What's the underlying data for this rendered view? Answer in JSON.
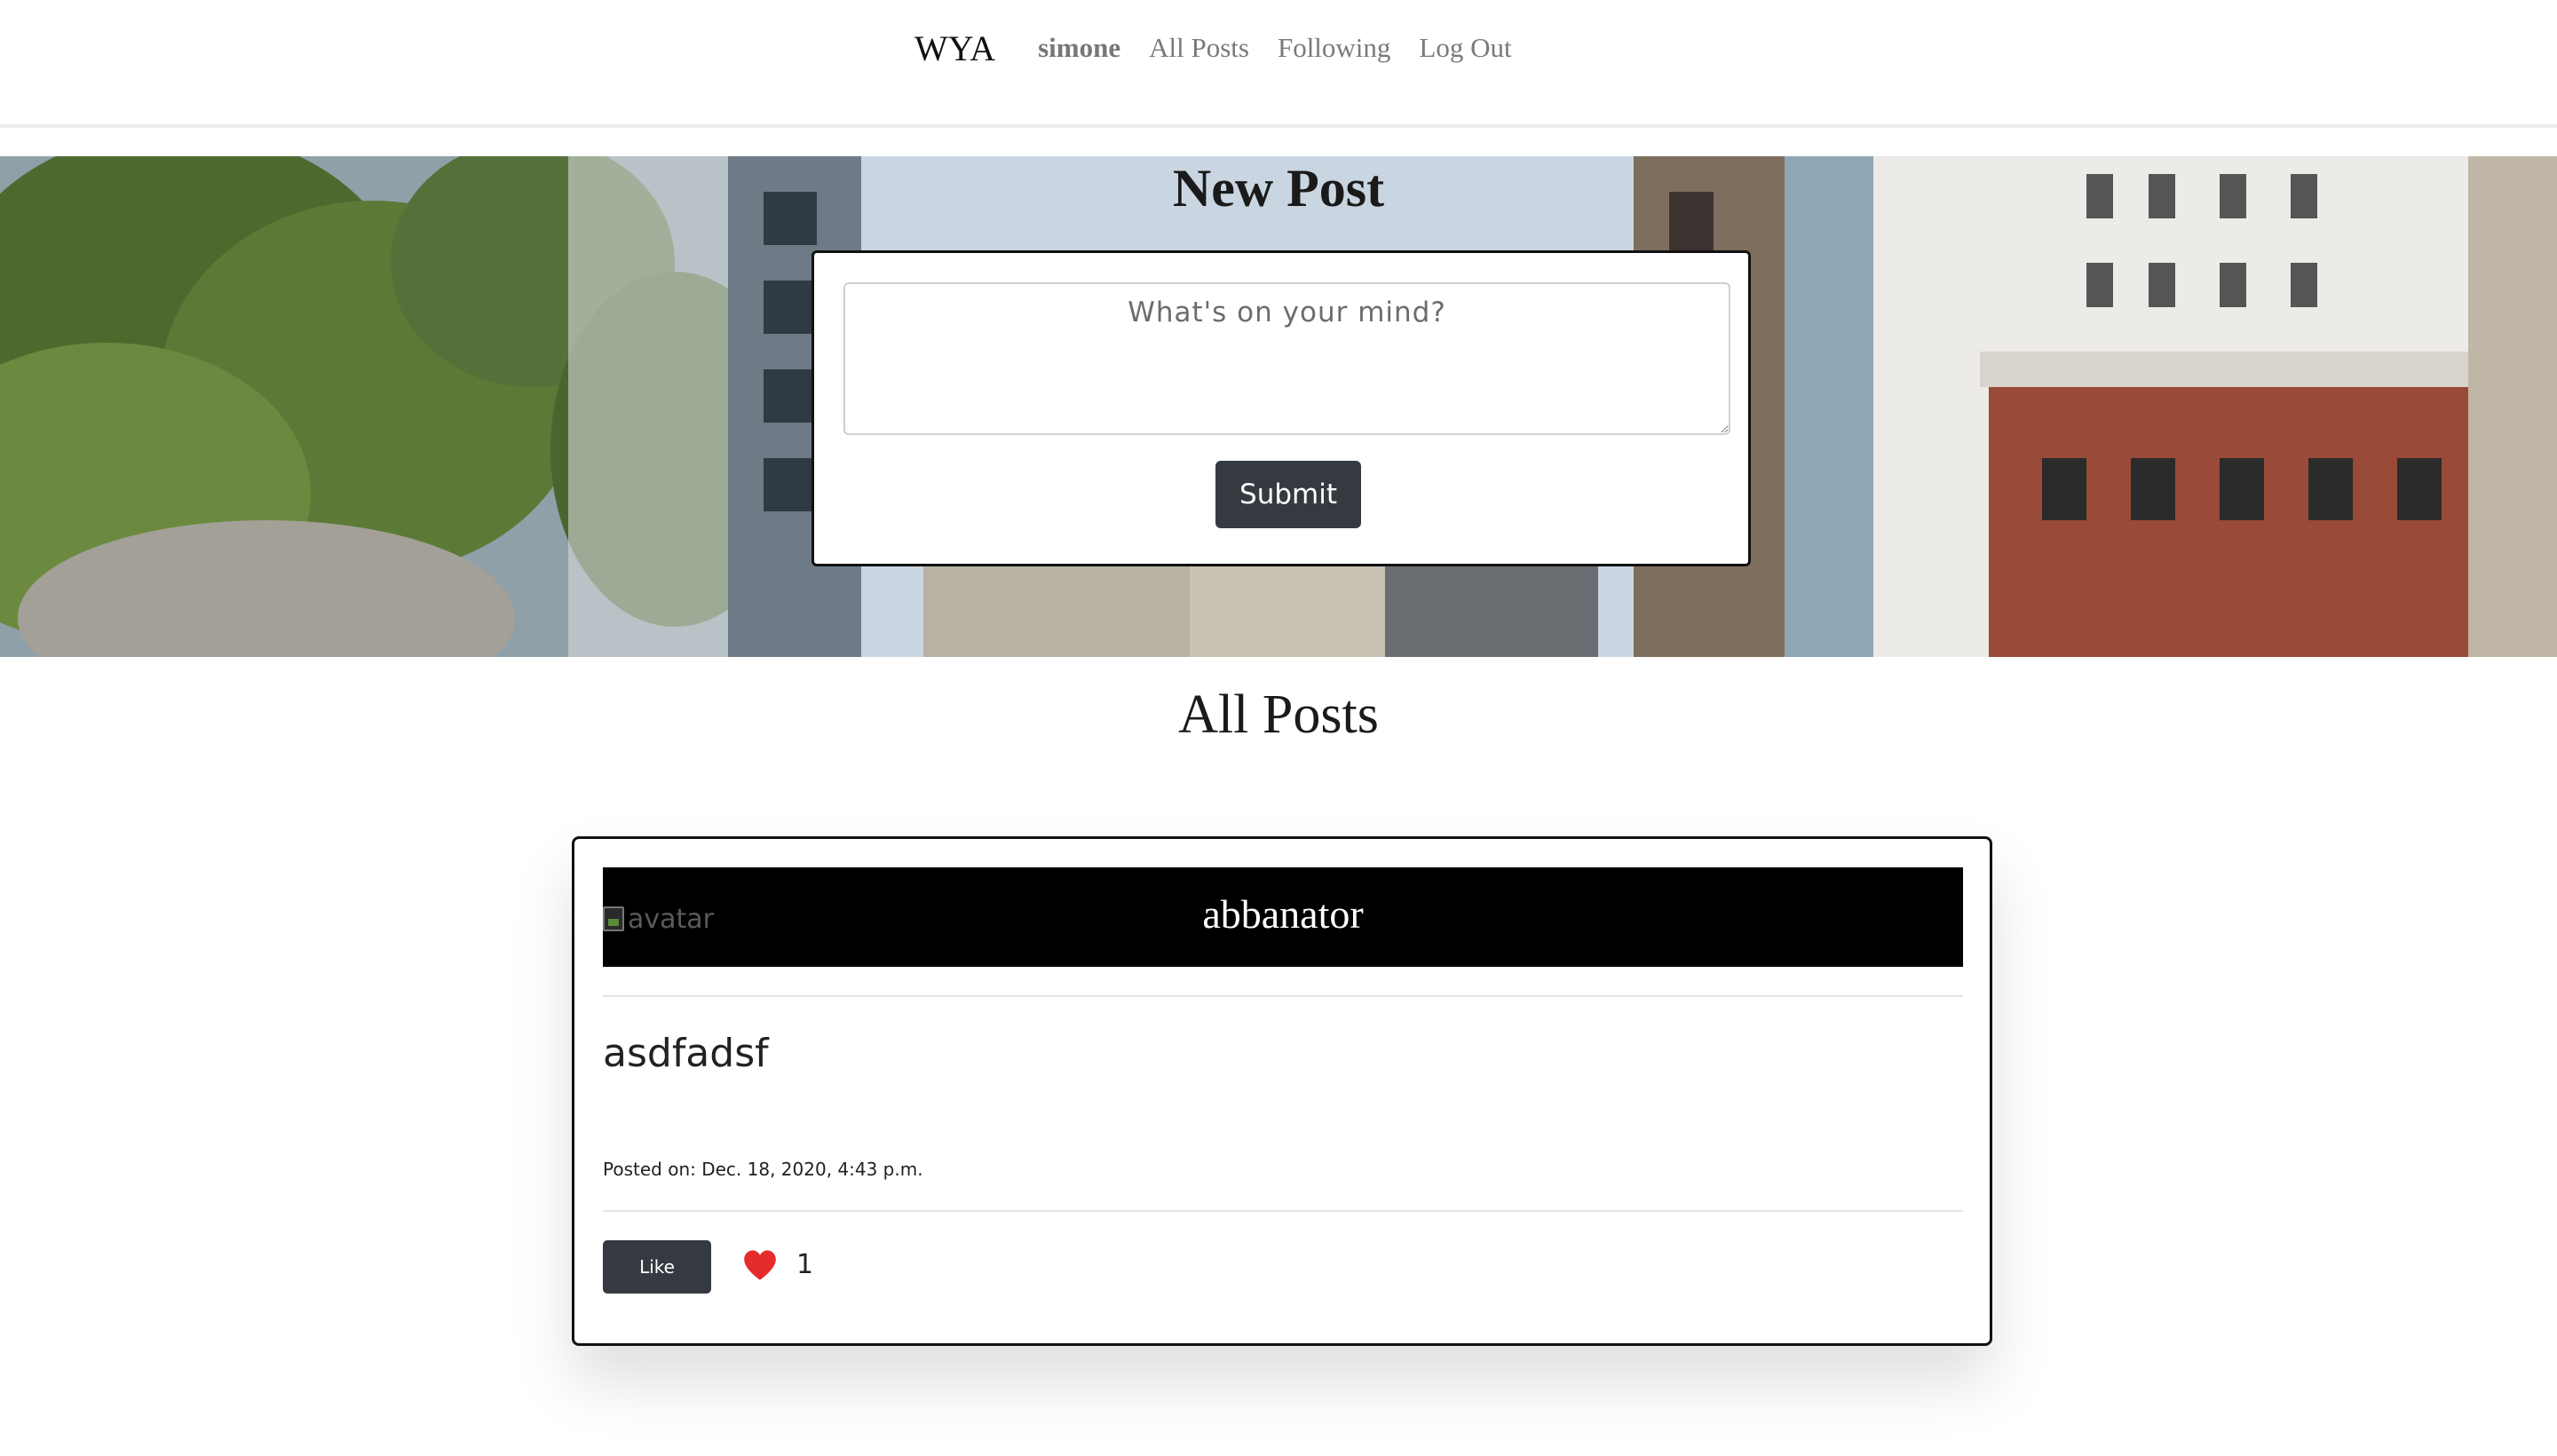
{
  "nav": {
    "brand": "WYA",
    "user": "simone",
    "links": [
      "All Posts",
      "Following",
      "Log Out"
    ]
  },
  "new_post": {
    "title": "New Post",
    "placeholder": "What's on your mind?",
    "submit_label": "Submit"
  },
  "all_posts": {
    "title": "All Posts"
  },
  "posts": [
    {
      "avatar_alt": "avatar",
      "author": "abbanator",
      "content": "asdfadsf",
      "posted_on": "Posted on: Dec. 18, 2020, 4:43 p.m.",
      "like_label": "Like",
      "likes": "1"
    }
  ],
  "colors": {
    "button_dark": "#343a40",
    "heart": "#e52b2b",
    "post_header_bg": "#000000"
  }
}
